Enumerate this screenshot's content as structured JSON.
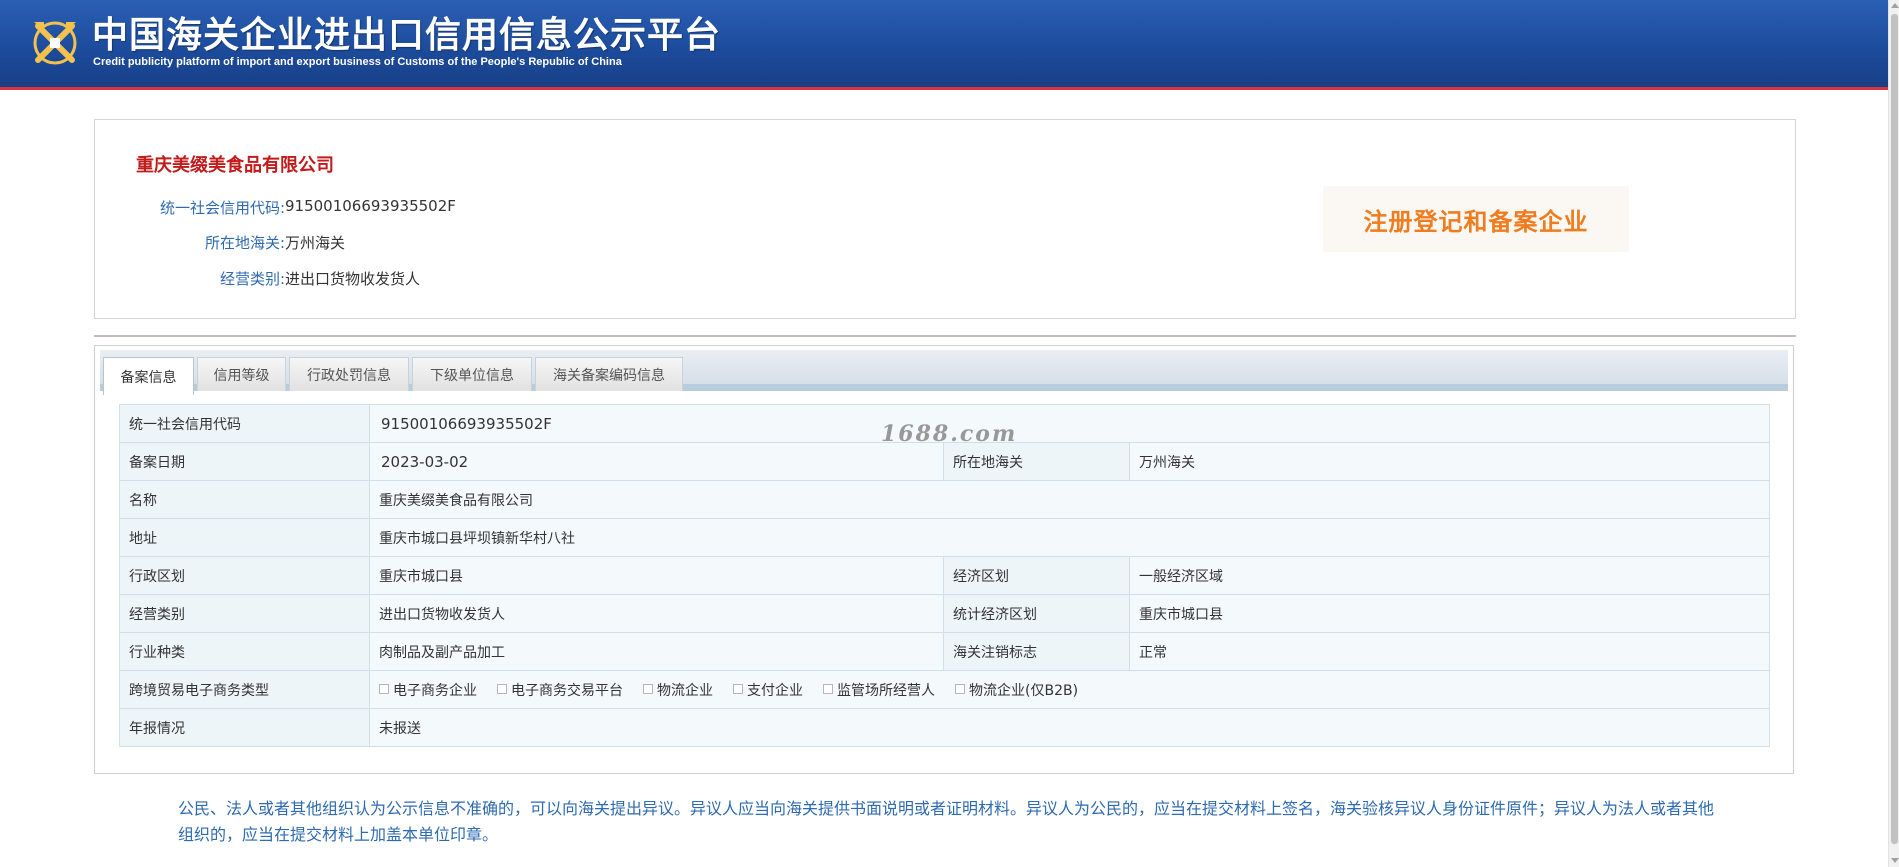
{
  "header": {
    "title_cn": "中国海关企业进出口信用信息公示平台",
    "title_en": "Credit publicity platform of import and export business of Customs of the People's Republic of China",
    "logo_icon": "customs-emblem-icon"
  },
  "company": {
    "name": "重庆美缀美食品有限公司",
    "info": [
      {
        "label": "统一社会信用代码:",
        "value": "91500106693935502F"
      },
      {
        "label": "所在地海关:",
        "value": "万州海关"
      },
      {
        "label": "经营类别:",
        "value": "进出口货物收发货人"
      }
    ],
    "stamp_text": "注册登记和备案企业"
  },
  "tabs": [
    {
      "label": "备案信息",
      "active": true
    },
    {
      "label": "信用等级",
      "active": false
    },
    {
      "label": "行政处罚信息",
      "active": false
    },
    {
      "label": "下级单位信息",
      "active": false
    },
    {
      "label": "海关备案编码信息",
      "active": false
    }
  ],
  "table": {
    "credit_code_label": "统一社会信用代码",
    "credit_code_value": "91500106693935502F",
    "record_date_label": "备案日期",
    "record_date_value": "2023-03-02",
    "customs_label": "所在地海关",
    "customs_value": "万州海关",
    "name_label": "名称",
    "name_value": "重庆美缀美食品有限公司",
    "address_label": "地址",
    "address_value": "重庆市城口县坪坝镇新华村八社",
    "admin_region_label": "行政区划",
    "admin_region_value": "重庆市城口县",
    "econ_region_label": "经济区划",
    "econ_region_value": "一般经济区域",
    "business_type_label": "经营类别",
    "business_type_value": "进出口货物收发货人",
    "stat_region_label": "统计经济区划",
    "stat_region_value": "重庆市城口县",
    "industry_label": "行业种类",
    "industry_value": "肉制品及副产品加工",
    "cancel_flag_label": "海关注销标志",
    "cancel_flag_value": "正常",
    "ecommerce_label": "跨境贸易电子商务类型",
    "ecommerce_options": [
      "电子商务企业",
      "电子商务交易平台",
      "物流企业",
      "支付企业",
      "监管场所经营人",
      "物流企业(仅B2B)"
    ],
    "annual_report_label": "年报情况",
    "annual_report_value": "未报送"
  },
  "watermark": "1688.com",
  "notice": "公民、法人或者其他组织认为公示信息不准确的，可以向海关提出异议。异议人应当向海关提供书面说明或者证明材料。异议人为公民的，应当在提交材料上签名，海关验核异议人身份证件原件；异议人为法人或者其他组织的，应当在提交材料上加盖本单位印章。"
}
